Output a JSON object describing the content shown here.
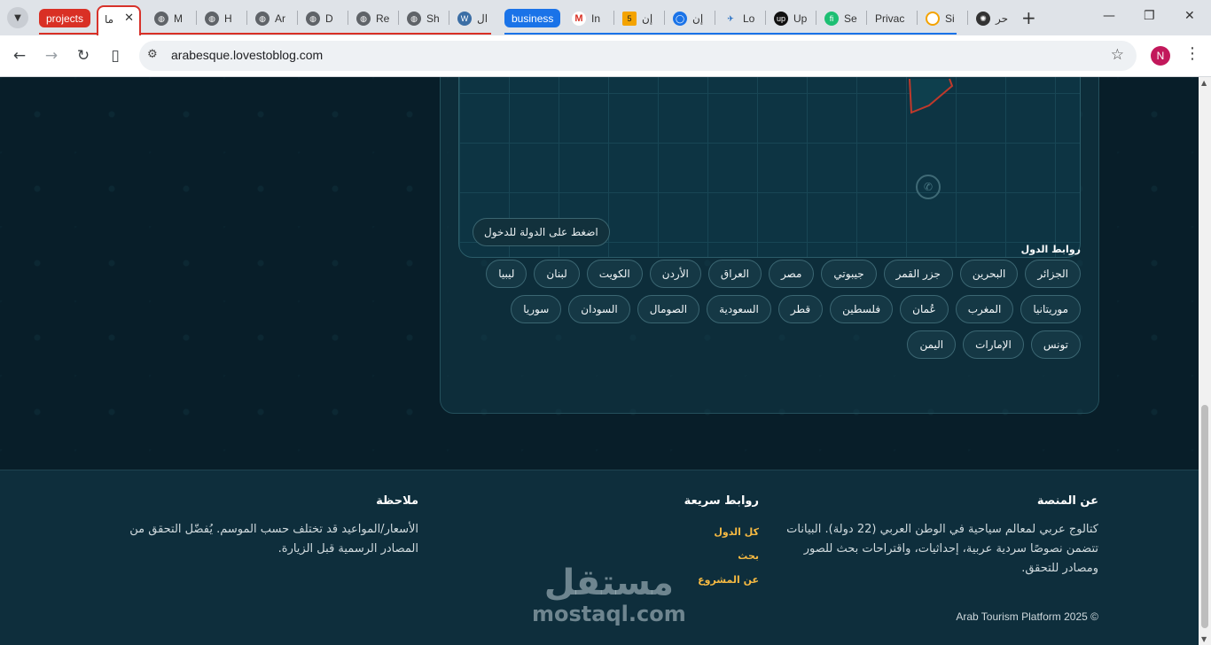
{
  "browser": {
    "group_projects": "projects",
    "group_business": "business",
    "active_tab_title": "ما",
    "tabs": [
      "M",
      "H",
      "Ar",
      "D",
      "Re",
      "Sh",
      "ال",
      "In",
      "إن",
      "إن",
      "Lo",
      "Up",
      "Se",
      "Privac",
      "Si",
      "حر"
    ],
    "new_tab": "+",
    "url": "arabesque.lovestoblog.com",
    "profile_initial": "N",
    "colors": {
      "projects": "#d93025",
      "business": "#1a73e8"
    }
  },
  "map": {
    "hint": "اضغط على الدولة للدخول"
  },
  "links": {
    "title": "روابط الدول",
    "countries": [
      "الجزائر",
      "البحرين",
      "جزر القمر",
      "جيبوتي",
      "مصر",
      "العراق",
      "الأردن",
      "الكويت",
      "لبنان",
      "ليبيا",
      "موريتانيا",
      "المغرب",
      "عُمان",
      "فلسطين",
      "قطر",
      "السعودية",
      "الصومال",
      "السودان",
      "سوريا",
      "تونس",
      "الإمارات",
      "اليمن"
    ]
  },
  "footer": {
    "about_title": "عن المنصة",
    "about_text": "كتالوج عربي لمعالم سياحية في الوطن العربي (22 دولة). البيانات تتضمن نصوصًا سردية عربية، إحداثيات، واقتراحات بحث للصور ومصادر للتحقق.",
    "quick_title": "روابط سريعة",
    "quick_links": [
      "كل الدول",
      "بحث",
      "عن المشروع"
    ],
    "note_title": "ملاحظة",
    "note_text": "الأسعار/المواعيد قد تختلف حسب الموسم. يُفضّل التحقق من المصادر الرسمية قبل الزيارة.",
    "copyright": "Arab Tourism Platform 2025 ©",
    "watermark_ar": "مستقل",
    "watermark_en": "mostaql.com"
  }
}
